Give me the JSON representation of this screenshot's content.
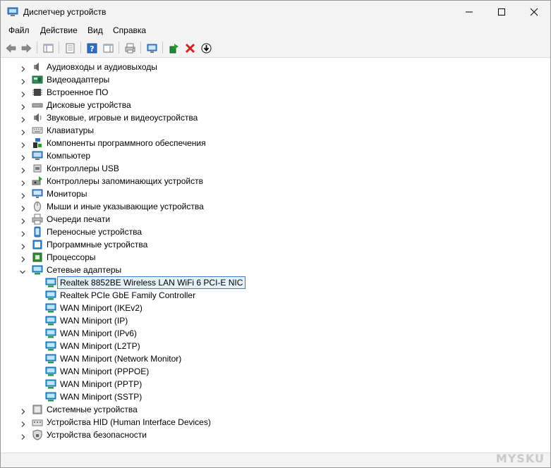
{
  "window": {
    "title": "Диспетчер устройств"
  },
  "menu": {
    "items": [
      "Файл",
      "Действие",
      "Вид",
      "Справка"
    ]
  },
  "tree": {
    "categories": [
      {
        "label": "Аудиовходы и аудиовыходы",
        "icon": "speaker-icon",
        "expanded": false
      },
      {
        "label": "Видеоадаптеры",
        "icon": "display-adapter-icon",
        "expanded": false
      },
      {
        "label": "Встроенное ПО",
        "icon": "firmware-icon",
        "expanded": false
      },
      {
        "label": "Дисковые устройства",
        "icon": "disk-drive-icon",
        "expanded": false
      },
      {
        "label": "Звуковые, игровые и видеоустройства",
        "icon": "sound-icon",
        "expanded": false
      },
      {
        "label": "Клавиатуры",
        "icon": "keyboard-icon",
        "expanded": false
      },
      {
        "label": "Компоненты программного обеспечения",
        "icon": "software-component-icon",
        "expanded": false
      },
      {
        "label": "Компьютер",
        "icon": "computer-icon",
        "expanded": false
      },
      {
        "label": "Контроллеры USB",
        "icon": "usb-icon",
        "expanded": false
      },
      {
        "label": "Контроллеры запоминающих устройств",
        "icon": "storage-controller-icon",
        "expanded": false
      },
      {
        "label": "Мониторы",
        "icon": "monitor-icon",
        "expanded": false
      },
      {
        "label": "Мыши и иные указывающие устройства",
        "icon": "mouse-icon",
        "expanded": false
      },
      {
        "label": "Очереди печати",
        "icon": "printer-icon",
        "expanded": false
      },
      {
        "label": "Переносные устройства",
        "icon": "portable-device-icon",
        "expanded": false
      },
      {
        "label": "Программные устройства",
        "icon": "software-device-icon",
        "expanded": false
      },
      {
        "label": "Процессоры",
        "icon": "processor-icon",
        "expanded": false
      },
      {
        "label": "Сетевые адаптеры",
        "icon": "network-adapter-icon",
        "expanded": true,
        "children": [
          "Realtek 8852BE Wireless LAN WiFi 6 PCI-E NIC",
          "Realtek PCIe GbE Family Controller",
          "WAN Miniport (IKEv2)",
          "WAN Miniport (IP)",
          "WAN Miniport (IPv6)",
          "WAN Miniport (L2TP)",
          "WAN Miniport (Network Monitor)",
          "WAN Miniport (PPPOE)",
          "WAN Miniport (PPTP)",
          "WAN Miniport (SSTP)"
        ]
      },
      {
        "label": "Системные устройства",
        "icon": "system-device-icon",
        "expanded": false
      },
      {
        "label": "Устройства HID (Human Interface Devices)",
        "icon": "hid-icon",
        "expanded": false
      },
      {
        "label": "Устройства безопасности",
        "icon": "security-device-icon",
        "expanded": false
      }
    ],
    "selected": "Realtek 8852BE Wireless LAN WiFi 6 PCI-E NIC"
  },
  "watermark": "MYSKU",
  "colors": {
    "chrome": "#f3f3f3",
    "selection_border": "#3b80d0",
    "selection_fill": "#e5f0fb",
    "network_icon": "#1e8fd6"
  }
}
